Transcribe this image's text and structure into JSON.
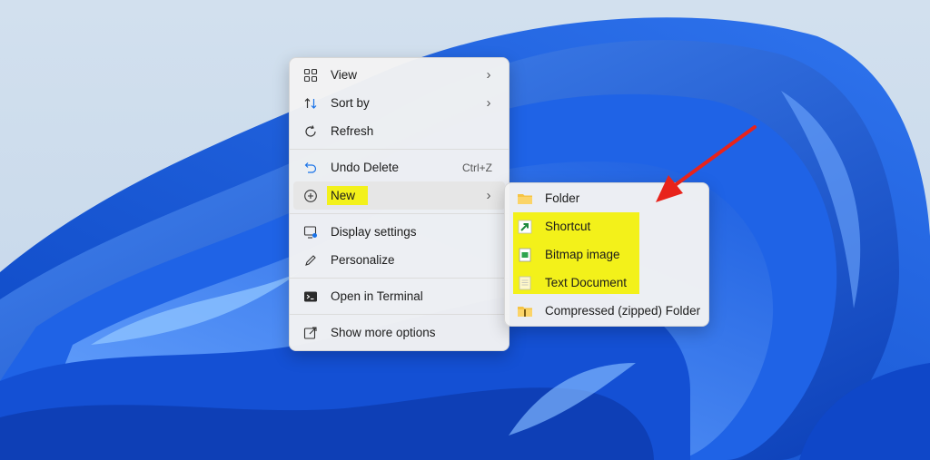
{
  "context_menu": {
    "items": [
      {
        "label": "View",
        "icon": "grid-icon",
        "submenu": true
      },
      {
        "label": "Sort by",
        "icon": "sort-icon",
        "submenu": true
      },
      {
        "label": "Refresh",
        "icon": "refresh-icon"
      },
      {
        "label": "Undo Delete",
        "icon": "undo-icon",
        "shortcut": "Ctrl+Z"
      },
      {
        "label": "New",
        "icon": "plus-circle-icon",
        "submenu": true
      },
      {
        "label": "Display settings",
        "icon": "display-settings-icon"
      },
      {
        "label": "Personalize",
        "icon": "pen-icon"
      },
      {
        "label": "Open in Terminal",
        "icon": "terminal-icon"
      },
      {
        "label": "Show more options",
        "icon": "share-icon"
      }
    ]
  },
  "new_submenu": {
    "items": [
      {
        "label": "Folder",
        "icon": "folder-icon"
      },
      {
        "label": "Shortcut",
        "icon": "shortcut-icon"
      },
      {
        "label": "Bitmap image",
        "icon": "bitmap-icon"
      },
      {
        "label": "Text Document",
        "icon": "text-document-icon"
      },
      {
        "label": "Compressed (zipped) Folder",
        "icon": "zip-folder-icon"
      }
    ]
  },
  "colors": {
    "highlight": "#f3f11a",
    "arrow": "#e8231b",
    "wallpaper_bg": "#c9d9ea",
    "bloom_blue": "#1a5fe0"
  }
}
